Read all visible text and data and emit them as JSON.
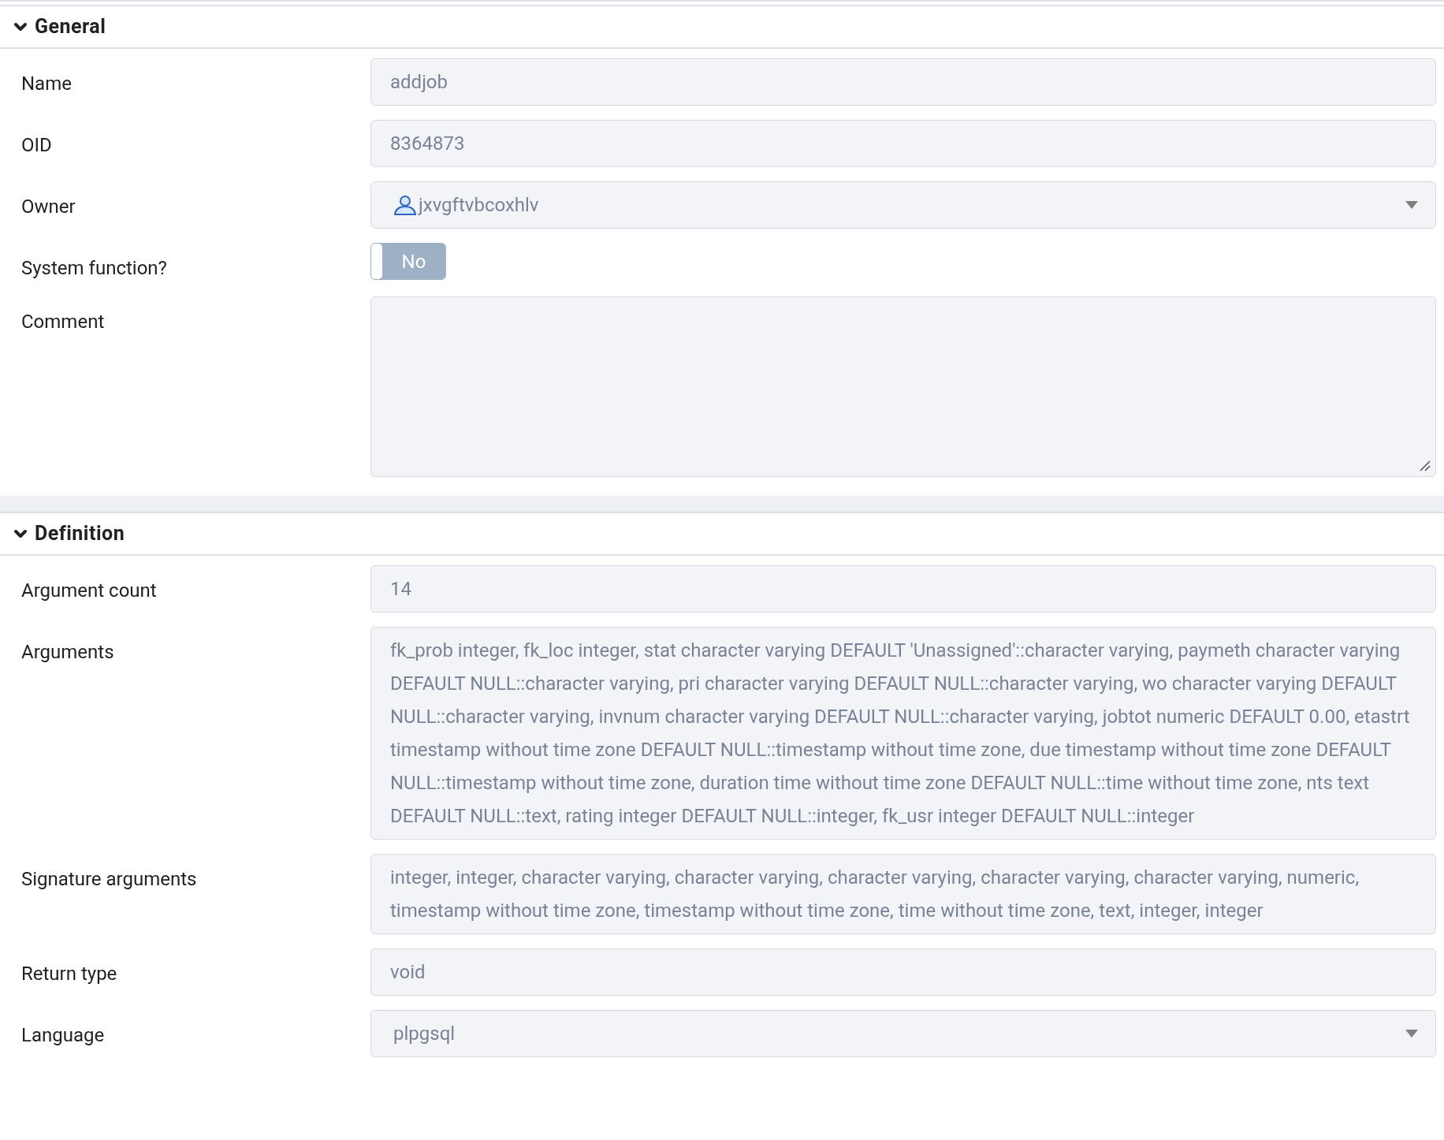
{
  "sections": [
    {
      "title": "General",
      "expanded": true,
      "fields": [
        {
          "label": "Name",
          "kind": "input",
          "value": "addjob"
        },
        {
          "label": "OID",
          "kind": "input",
          "value": "8364873"
        },
        {
          "label": "Owner",
          "kind": "user-select",
          "value": "jxvgftvbcoxhlv"
        },
        {
          "label": "System function?",
          "kind": "toggle",
          "on": false,
          "value": "No"
        },
        {
          "label": "Comment",
          "kind": "textarea"
        }
      ]
    },
    {
      "title": "Definition",
      "expanded": true,
      "fields": [
        {
          "label": "Argument count",
          "kind": "input",
          "value": "14"
        },
        {
          "label": "Arguments",
          "kind": "multiline",
          "value": "fk_prob integer, fk_loc integer, stat character varying DEFAULT 'Unassigned'::character varying, paymeth character varying DEFAULT NULL::character varying, pri character varying DEFAULT NULL::character varying, wo character varying DEFAULT NULL::character varying, invnum character varying DEFAULT NULL::character varying, jobtot numeric DEFAULT 0.00, etastrt timestamp without time zone DEFAULT NULL::timestamp without time zone, due timestamp without time zone DEFAULT NULL::timestamp without time zone, duration time without time zone DEFAULT NULL::time without time zone, nts text DEFAULT NULL::text, rating integer DEFAULT NULL::integer, fk_usr integer DEFAULT NULL::integer"
        },
        {
          "label": "Signature arguments",
          "kind": "multiline",
          "value": "integer, integer, character varying, character varying, character varying, character varying, character varying, numeric, timestamp without time zone, timestamp without time zone, time without time zone, text, integer, integer"
        },
        {
          "label": "Return type",
          "kind": "input",
          "value": "void"
        },
        {
          "label": "Language",
          "kind": "select",
          "value": "plpgsql"
        }
      ]
    }
  ]
}
